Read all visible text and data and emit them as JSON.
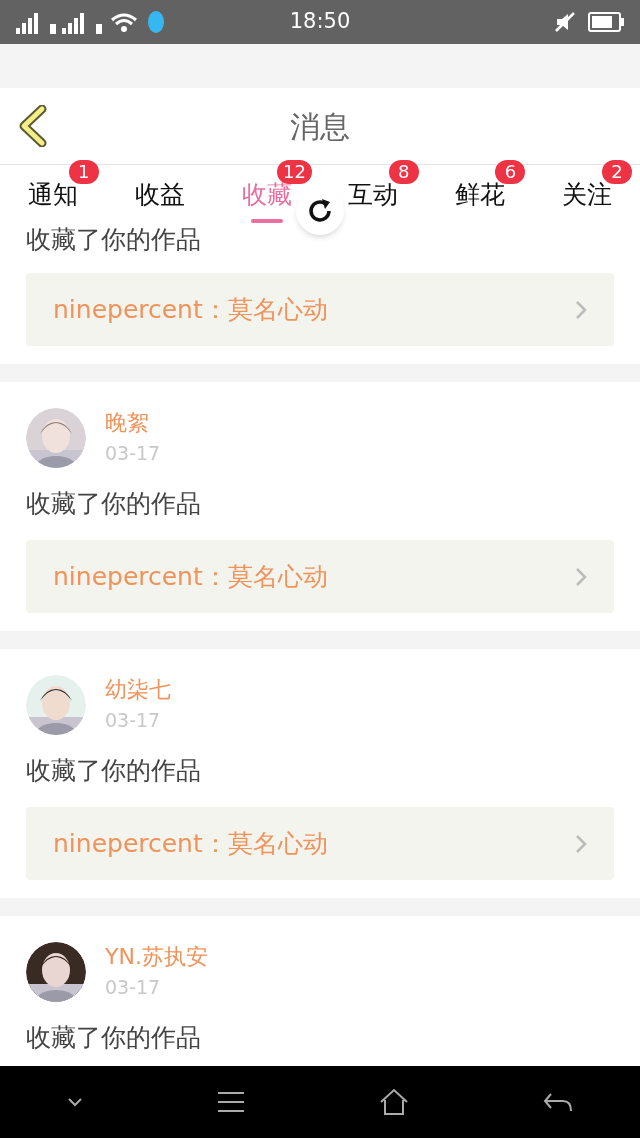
{
  "status_bar": {
    "time": "18:50"
  },
  "header": {
    "title": "消息"
  },
  "tabs": [
    {
      "label": "通知",
      "badge": "1",
      "selected": false
    },
    {
      "label": "收益",
      "selected": false
    },
    {
      "label": "收藏",
      "badge": "12",
      "selected": true
    },
    {
      "label": "互动",
      "badge": "8",
      "selected": false
    },
    {
      "label": "鲜花",
      "badge": "6",
      "selected": false
    },
    {
      "label": "关注",
      "badge": "2",
      "selected": false
    }
  ],
  "messages": [
    {
      "action": "收藏了你的作品",
      "work": "ninepercent：莫名心动"
    },
    {
      "user": "晚絮",
      "date": "03-17",
      "action": "收藏了你的作品",
      "work": "ninepercent：莫名心动"
    },
    {
      "user": "幼柒七",
      "date": "03-17",
      "action": "收藏了你的作品",
      "work": "ninepercent：莫名心动"
    },
    {
      "user": "YN.苏执安",
      "date": "03-17",
      "action": "收藏了你的作品"
    }
  ]
}
